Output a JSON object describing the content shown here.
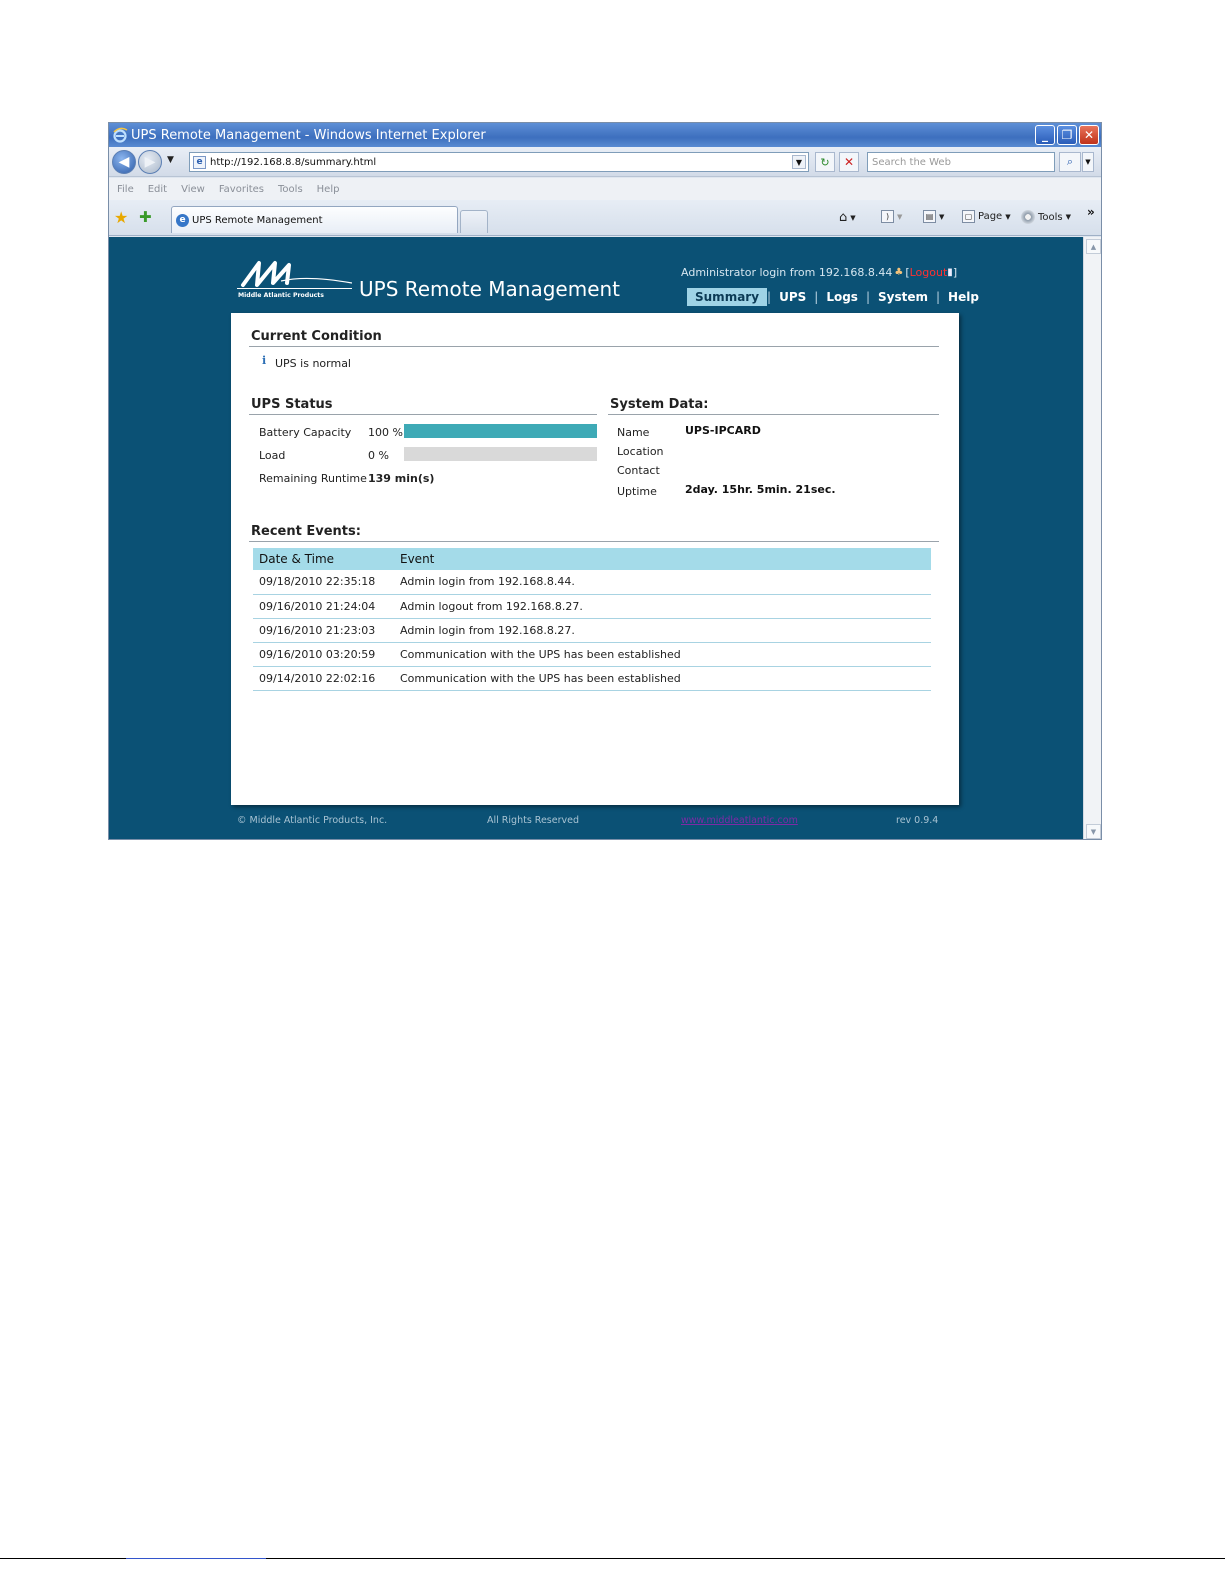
{
  "browser": {
    "window_title": "UPS Remote Management - Windows Internet Explorer",
    "address_url": "http://192.168.8.8/summary.html",
    "search_placeholder": "Search the Web",
    "menu": [
      "File",
      "Edit",
      "View",
      "Favorites",
      "Tools",
      "Help"
    ],
    "tab_title": "UPS Remote Management",
    "commands": {
      "page": "Page",
      "tools": "Tools"
    },
    "icons": [
      "ie-logo-icon",
      "back-icon",
      "forward-icon",
      "refresh-icon",
      "stop-icon",
      "search-icon",
      "favorites-star-icon",
      "add-favorites-icon",
      "home-icon",
      "feeds-icon",
      "print-icon",
      "page-icon",
      "tools-gear-icon",
      "chevron-more-icon"
    ]
  },
  "app": {
    "title": "UPS Remote Management",
    "logo_text": "Middle Atlantic Products",
    "login_text": "Administrator login from 192.168.8.44",
    "logout_label": "Logout",
    "nav": [
      {
        "label": "Summary",
        "active": true
      },
      {
        "label": "UPS",
        "active": false
      },
      {
        "label": "Logs",
        "active": false
      },
      {
        "label": "System",
        "active": false
      },
      {
        "label": "Help",
        "active": false
      }
    ]
  },
  "current_condition": {
    "title": "Current Condition",
    "message": "UPS is normal"
  },
  "ups_status": {
    "title": "UPS Status",
    "battery_label": "Battery Capacity",
    "battery_value": "100 %",
    "battery_fraction": 1.0,
    "load_label": "Load",
    "load_value": "0 %",
    "load_fraction": 0.0,
    "runtime_label": "Remaining Runtime",
    "runtime_value": "139 min(s)",
    "bar_color": "#3eaab6"
  },
  "system_data": {
    "title": "System Data:",
    "name_label": "Name",
    "name_value": "UPS-IPCARD",
    "location_label": "Location",
    "location_value": "",
    "contact_label": "Contact",
    "contact_value": "",
    "uptime_label": "Uptime",
    "uptime_value": "2day. 15hr. 5min. 21sec."
  },
  "recent_events": {
    "title": "Recent Events:",
    "headers": [
      "Date & Time",
      "Event"
    ],
    "rows": [
      [
        "09/18/2010 22:35:18",
        "Admin login from 192.168.8.44."
      ],
      [
        "09/16/2010 21:24:04",
        "Admin logout from 192.168.8.27."
      ],
      [
        "09/16/2010 21:23:03",
        "Admin login from 192.168.8.27."
      ],
      [
        "09/16/2010 03:20:59",
        "Communication with the UPS has been established"
      ],
      [
        "09/14/2010 22:02:16",
        "Communication with the UPS has been established"
      ]
    ]
  },
  "footer": {
    "copyright": "© Middle Atlantic Products, Inc.",
    "rights": "All Rights Reserved",
    "link": "www.middleatlantic.com",
    "revision": "rev 0.9.4"
  },
  "colors": {
    "page_background": "#0b5175",
    "nav_active": "#9fd3e6",
    "table_header": "#a4dbe9",
    "logout": "#ff3030"
  }
}
